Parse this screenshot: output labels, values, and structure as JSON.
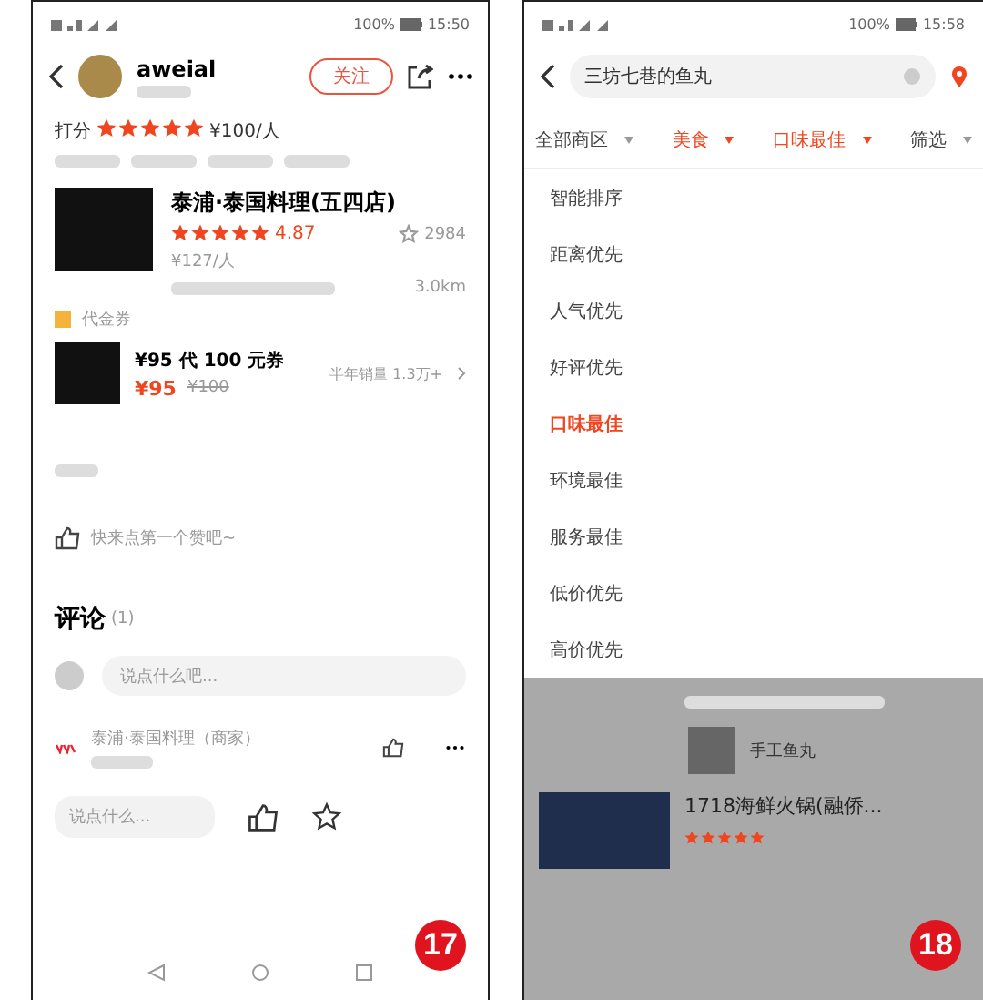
{
  "left": {
    "status": {
      "battery": "100%",
      "time": "15:50"
    },
    "user": {
      "name": "aweial"
    },
    "follow": "关注",
    "rating": {
      "label": "打分",
      "stars": 5,
      "price": "¥100/人"
    },
    "shop": {
      "name": "泰浦·泰国料理(五四店)",
      "stars": 5,
      "score": "4.87",
      "price": "¥127/人",
      "favorites": "2984",
      "distance": "3.0km"
    },
    "coupon_tag": "代金券",
    "coupon": {
      "title": "¥95 代 100 元券",
      "price": "¥95",
      "original": "¥100",
      "sales": "半年销量 1.3万+"
    },
    "like_prompt": "快来点第一个赞吧~",
    "comments": {
      "title": "评论",
      "count": "(1)",
      "placeholder": "说点什么吧...",
      "author": "泰浦·泰国料理（商家）"
    },
    "bottom_placeholder": "说点什么...",
    "badge": "17"
  },
  "right": {
    "status": {
      "battery": "100%",
      "time": "15:58"
    },
    "search": {
      "value": "三坊七巷的鱼丸"
    },
    "filters": [
      {
        "label": "全部商区",
        "selected": false
      },
      {
        "label": "美食",
        "selected": true
      },
      {
        "label": "口味最佳",
        "selected": true
      },
      {
        "label": "筛选",
        "selected": false
      }
    ],
    "sort_options": [
      {
        "label": "智能排序",
        "selected": false
      },
      {
        "label": "距离优先",
        "selected": false
      },
      {
        "label": "人气优先",
        "selected": false
      },
      {
        "label": "好评优先",
        "selected": false
      },
      {
        "label": "口味最佳",
        "selected": true
      },
      {
        "label": "环境最佳",
        "selected": false
      },
      {
        "label": "服务最佳",
        "selected": false
      },
      {
        "label": "低价优先",
        "selected": false
      },
      {
        "label": "高价优先",
        "selected": false
      }
    ],
    "dish": {
      "name": "手工鱼丸"
    },
    "result": {
      "name": "1718海鲜火锅(融侨...",
      "stars": 5
    },
    "badge": "18"
  }
}
